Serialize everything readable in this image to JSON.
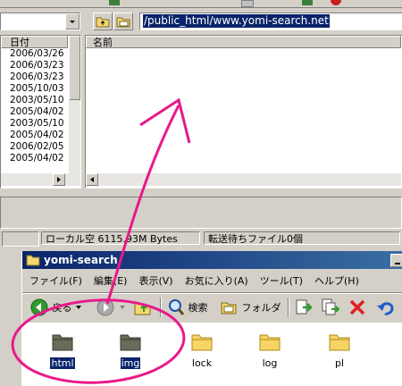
{
  "ftp": {
    "remote_path": "/public_html/www.yomi-search.net",
    "left_column_header": "日付",
    "right_column_header": "名前",
    "dates": [
      "2006/03/26",
      "2006/03/23",
      "2006/03/23",
      "2005/10/03",
      "2003/05/10",
      "2005/04/02",
      "2003/05/10",
      "2005/04/02",
      "2006/02/05",
      "2005/04/02"
    ],
    "status_local": "ローカル空 6115.93M Bytes",
    "status_queue": "転送待ちファイル0個"
  },
  "explorer": {
    "title": "yomi-search",
    "menu": [
      "ファイル(F)",
      "編集(E)",
      "表示(V)",
      "お気に入り(A)",
      "ツール(T)",
      "ヘルプ(H)"
    ],
    "back_label": "戻る",
    "search_label": "検索",
    "folders_label": "フォルダ",
    "files": [
      {
        "name": "html",
        "icon": "folder-dark-icon",
        "selected": true
      },
      {
        "name": "img",
        "icon": "folder-dark-icon",
        "selected": true
      },
      {
        "name": "lock",
        "icon": "folder-icon",
        "selected": false
      },
      {
        "name": "log",
        "icon": "folder-icon",
        "selected": false
      },
      {
        "name": "pl",
        "icon": "folder-icon",
        "selected": false
      }
    ]
  },
  "annotation": {
    "color": "#e8198b"
  }
}
